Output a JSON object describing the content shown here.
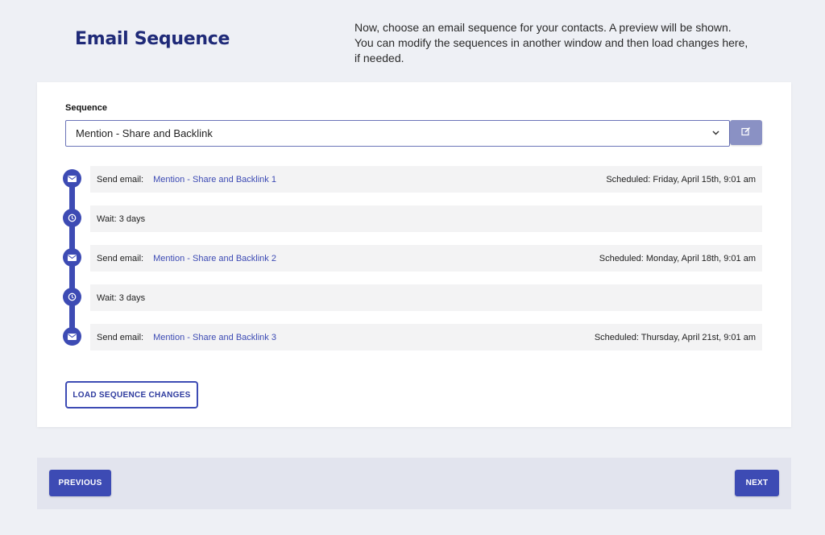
{
  "header": {
    "title": "Email Sequence",
    "description": "Now, choose an email sequence for your contacts. A preview will be shown. You can modify the sequences in another window and then load changes here, if needed."
  },
  "sequence": {
    "label": "Sequence",
    "selected": "Mention - Share and Backlink",
    "edit_icon": "edit-icon"
  },
  "steps": [
    {
      "type": "email",
      "icon": "envelope-icon",
      "label": "Send email:",
      "name": "Mention - Share and Backlink 1",
      "scheduled": "Scheduled: Friday, April 15th, 9:01 am"
    },
    {
      "type": "wait",
      "icon": "clock-icon",
      "label": "Wait: 3 days"
    },
    {
      "type": "email",
      "icon": "envelope-icon",
      "label": "Send email:",
      "name": "Mention - Share and Backlink 2",
      "scheduled": "Scheduled: Monday, April 18th, 9:01 am"
    },
    {
      "type": "wait",
      "icon": "clock-icon",
      "label": "Wait: 3 days"
    },
    {
      "type": "email",
      "icon": "envelope-icon",
      "label": "Send email:",
      "name": "Mention - Share and Backlink 3",
      "scheduled": "Scheduled: Thursday, April 21st, 9:01 am"
    }
  ],
  "actions": {
    "load_changes": "LOAD SEQUENCE CHANGES",
    "previous": "PREVIOUS",
    "next": "NEXT"
  },
  "colors": {
    "accent": "#3d4bb4",
    "title": "#1f2a78",
    "edit_button": "#8a91c4"
  }
}
